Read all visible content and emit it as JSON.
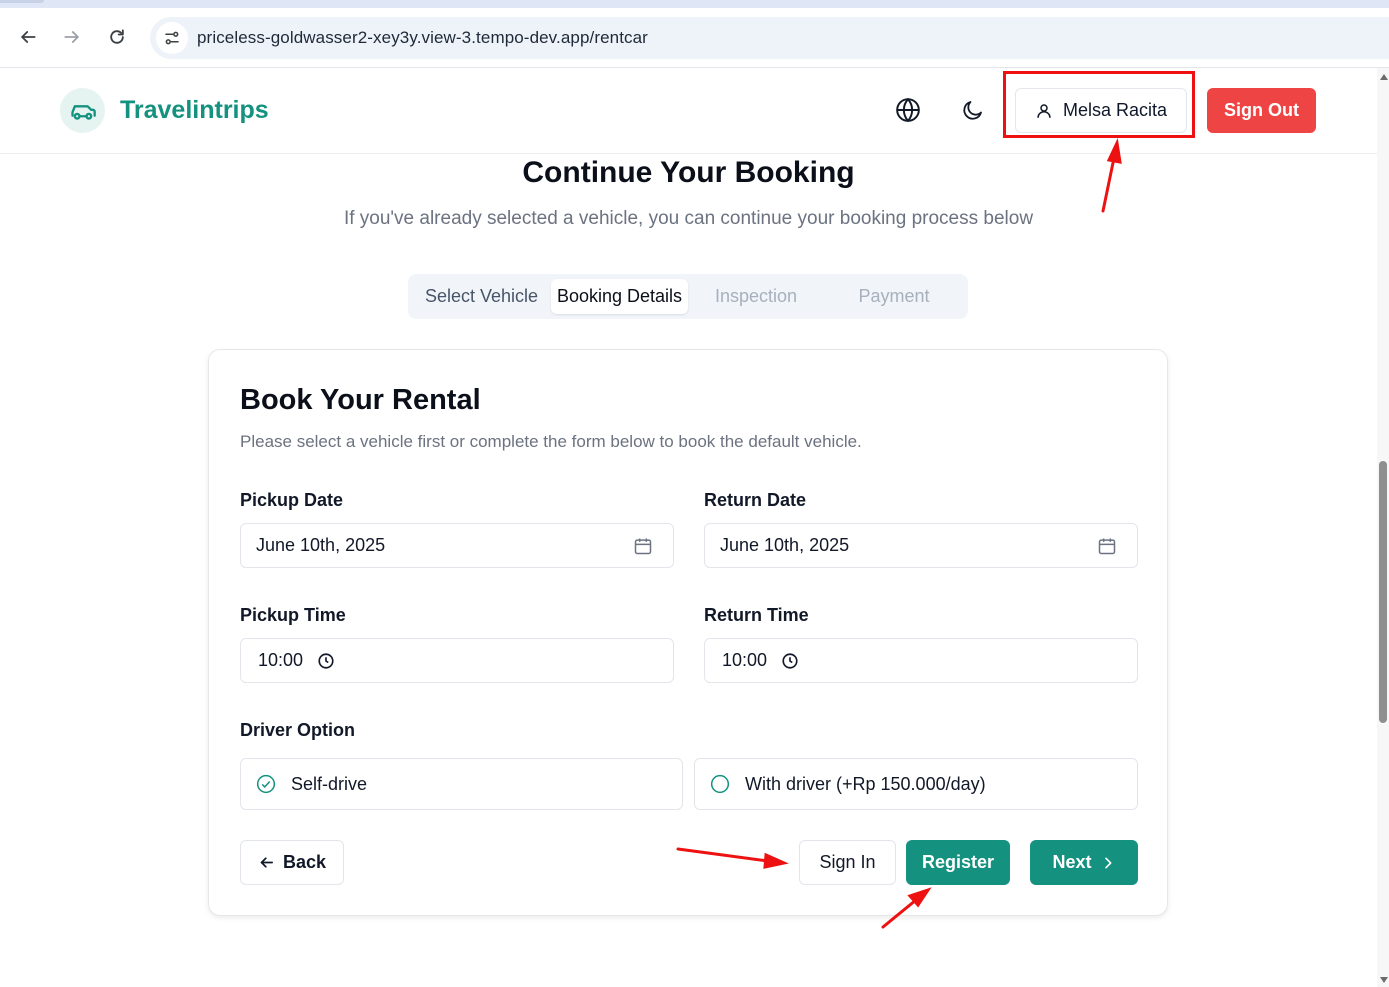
{
  "browser": {
    "url": "priceless-goldwasser2-xey3y.view-3.tempo-dev.app/rentcar",
    "icons": [
      "back-arrow-icon",
      "forward-arrow-icon",
      "reload-icon",
      "site-settings-icon"
    ]
  },
  "header": {
    "brand": "Travelintrips",
    "user_name": "Melsa Racita",
    "sign_out_label": "Sign Out",
    "icons": [
      "car-icon",
      "globe-icon",
      "moon-icon",
      "user-icon"
    ]
  },
  "page": {
    "title": "Continue Your Booking",
    "subtitle": "If you've already selected a vehicle, you can continue your booking process below"
  },
  "steps": [
    {
      "label": "Select Vehicle",
      "state": "done"
    },
    {
      "label": "Booking Details",
      "state": "active"
    },
    {
      "label": "Inspection",
      "state": "todo"
    },
    {
      "label": "Payment",
      "state": "todo"
    }
  ],
  "form": {
    "title": "Book Your Rental",
    "description": "Please select a vehicle first or complete the form below to book the default vehicle.",
    "pickup_date_label": "Pickup Date",
    "pickup_date_value": "June 10th, 2025",
    "return_date_label": "Return Date",
    "return_date_value": "June 10th, 2025",
    "pickup_time_label": "Pickup Time",
    "pickup_time_value": "10:00",
    "return_time_label": "Return Time",
    "return_time_value": "10:00",
    "driver_option_label": "Driver Option",
    "driver_options": [
      {
        "label": "Self-drive",
        "selected": true
      },
      {
        "label": "With driver (+Rp 150.000/day)",
        "selected": false
      }
    ]
  },
  "actions": {
    "back_label": "Back",
    "sign_in_label": "Sign In",
    "register_label": "Register",
    "next_label": "Next"
  },
  "colors": {
    "brand_teal": "#14917f",
    "sign_out_red": "#ef4444",
    "annotation_red": "#ee1111"
  }
}
